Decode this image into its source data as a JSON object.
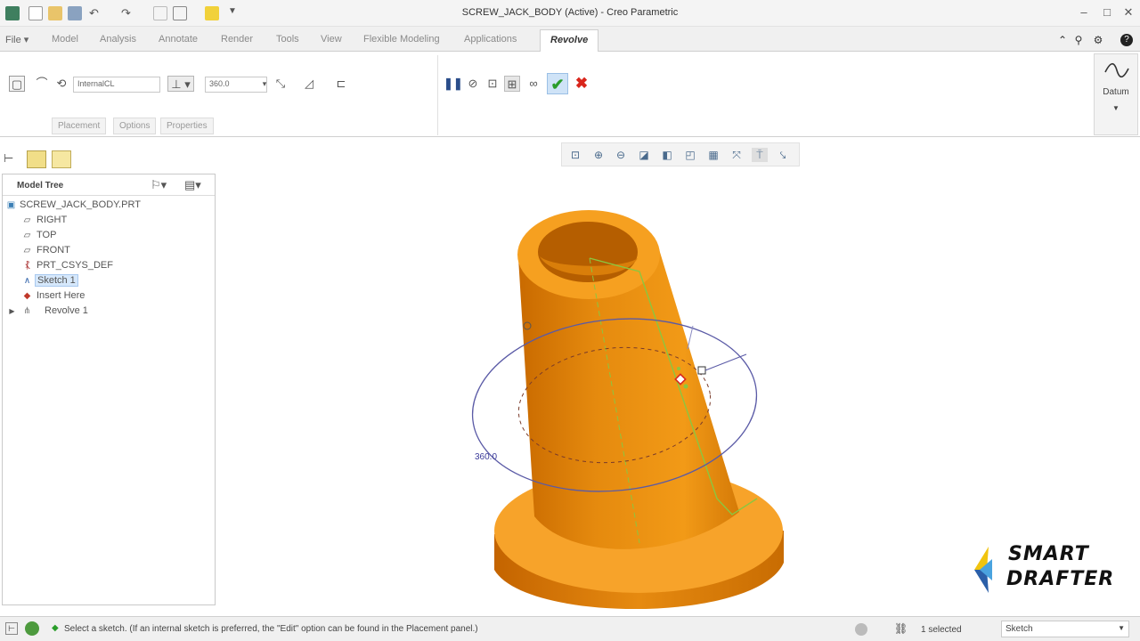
{
  "window": {
    "title": "SCREW_JACK_BODY (Active) - Creo Parametric"
  },
  "menu": {
    "file_label": "File",
    "tabs": [
      "Model",
      "Analysis",
      "Annotate",
      "Render",
      "Tools",
      "View",
      "Flexible Modeling",
      "Applications"
    ],
    "active_tab": "Revolve"
  },
  "ribbon": {
    "axis_input_value": "InternalCL",
    "angle_value": "360.0",
    "sub_tabs": [
      "Placement",
      "Options",
      "Properties"
    ],
    "datum_label": "Datum"
  },
  "model_tree": {
    "header": "Model Tree",
    "root": "SCREW_JACK_BODY.PRT",
    "items": [
      {
        "label": "RIGHT",
        "icon": "datum-plane-icon"
      },
      {
        "label": "TOP",
        "icon": "datum-plane-icon"
      },
      {
        "label": "FRONT",
        "icon": "datum-plane-icon"
      },
      {
        "label": "PRT_CSYS_DEF",
        "icon": "coordinate-system-icon"
      },
      {
        "label": "Sketch 1",
        "icon": "sketch-icon"
      },
      {
        "label": "Insert Here",
        "icon": "insert-arrow-icon"
      },
      {
        "label": "Revolve 1",
        "icon": "revolve-icon"
      }
    ]
  },
  "viewport": {
    "angle_dimension": "360.0"
  },
  "status": {
    "message": "Select a sketch. (If an internal sketch is preferred, the \"Edit\" option can be found in the Placement panel.)",
    "selected_count": "1 selected",
    "filter_value": "Sketch"
  },
  "logo": {
    "line1": "SMART",
    "line2": "DRAFTER"
  },
  "colors": {
    "model_orange": "#f29a17",
    "highlight_green": "#8cc63f",
    "confirm_green": "#2a9d2a",
    "cancel_red": "#d9261c",
    "dim_blue": "#3b3b9a"
  }
}
